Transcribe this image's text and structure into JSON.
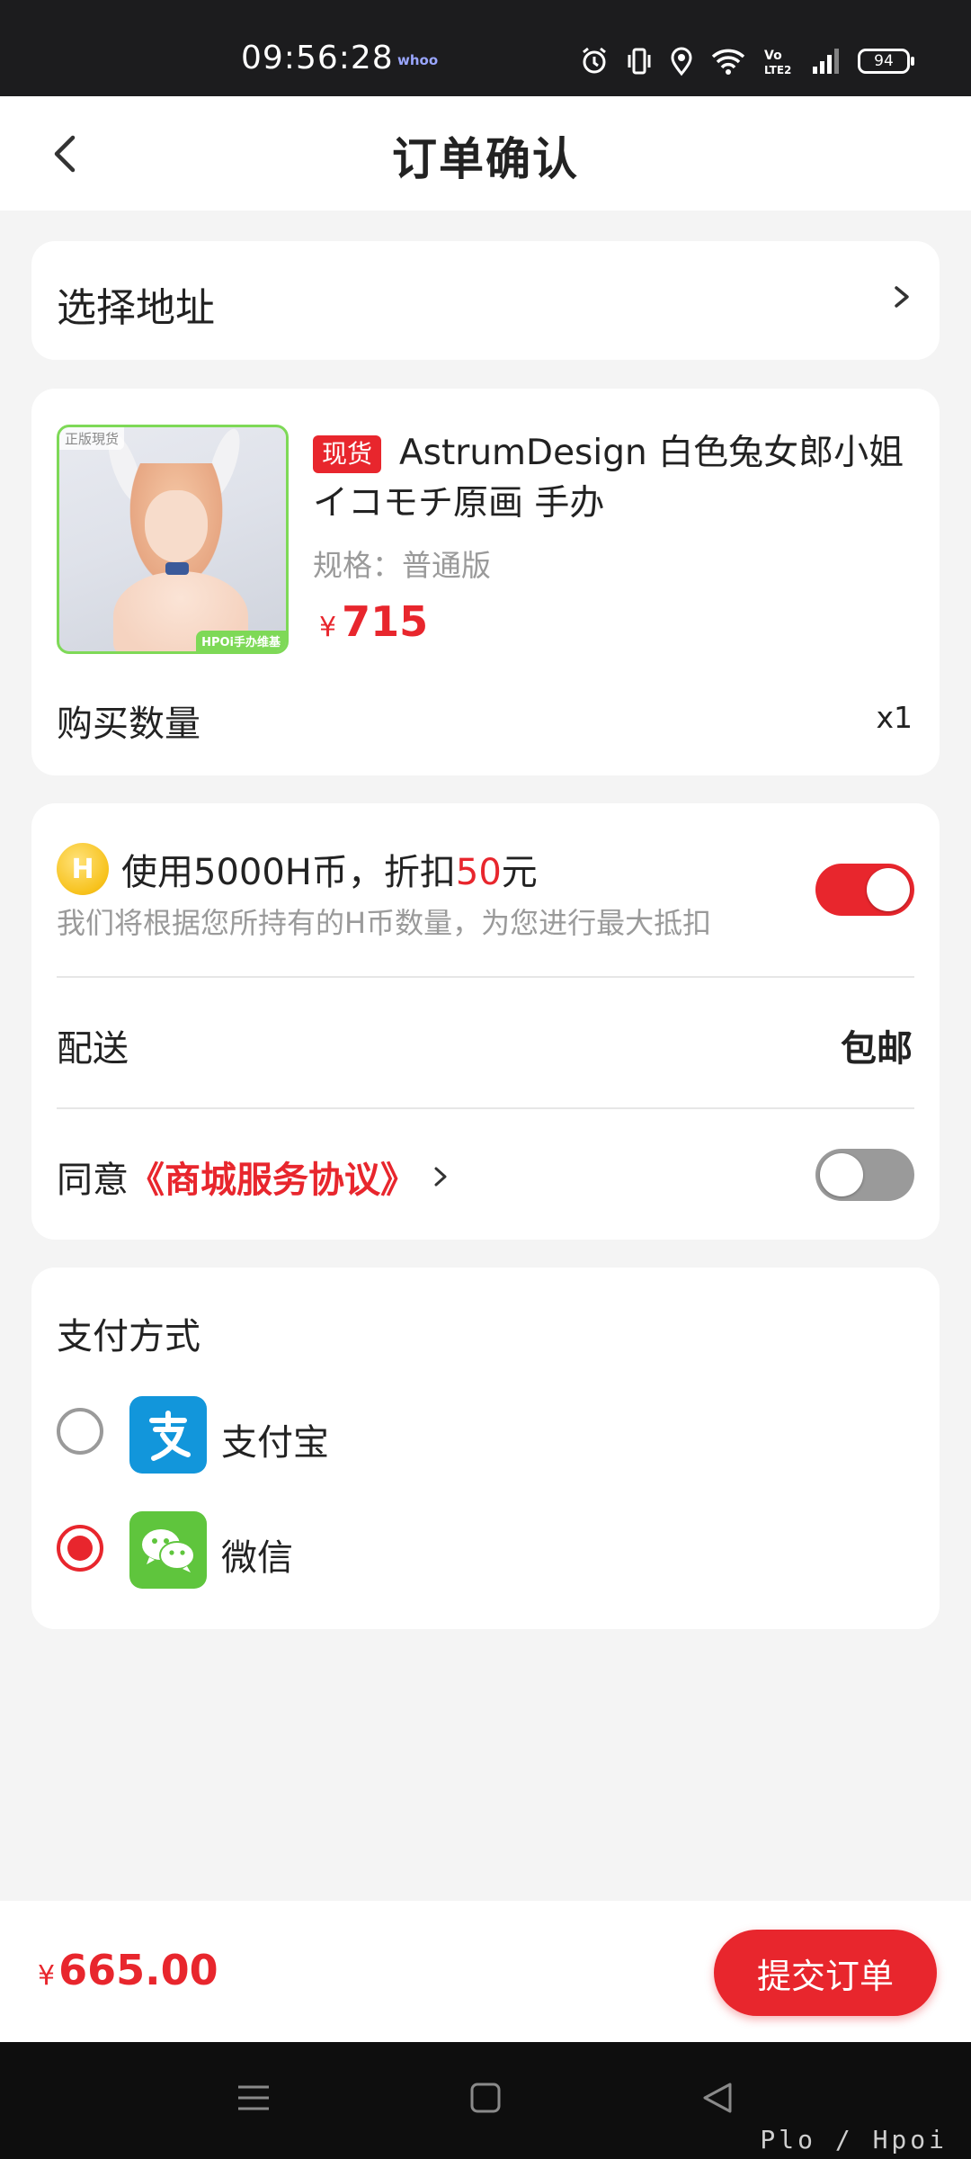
{
  "status_bar": {
    "time": "09:56:28",
    "carrier_mark": "whoo",
    "battery": "94",
    "icons": [
      "alarm-icon",
      "vibrate-icon",
      "location-icon",
      "wifi-icon",
      "volte-icon",
      "signal-icon",
      "battery-icon"
    ]
  },
  "header": {
    "title": "订单确认"
  },
  "address": {
    "label": "选择地址"
  },
  "product": {
    "stock_tag": "现货",
    "title": "AstrumDesign 白色兔女郎小姐 イコモチ原画 手办",
    "spec": "规格：普通版",
    "price_symbol": "¥",
    "price": "715",
    "image_tag": "正版現货",
    "image_brand": "HPOi手办维基",
    "qty_label": "购买数量",
    "qty_value": "x1"
  },
  "options": {
    "coin_badge": "H",
    "coin_prefix": "使用5000H币，折扣",
    "coin_amount": "50",
    "coin_suffix": "元",
    "coin_note": "我们将根据您所持有的H币数量，为您进行最大抵扣",
    "coin_enabled": true,
    "shipping_label": "配送",
    "shipping_value": "包邮",
    "agree_prefix": "同意",
    "agree_link": "《商城服务协议》",
    "agree_enabled": false
  },
  "payment": {
    "title": "支付方式",
    "methods": [
      {
        "label": "支付宝",
        "icon": "alipay-icon",
        "selected": false
      },
      {
        "label": "微信",
        "icon": "wechat-icon",
        "selected": true
      }
    ]
  },
  "footer": {
    "total_symbol": "¥",
    "total": "665.00",
    "submit_label": "提交订单"
  },
  "nav": {
    "icons": [
      "menu-icon",
      "home-icon",
      "back-icon"
    ],
    "watermark": "Plo / Hpoi"
  },
  "colors": {
    "accent": "#e8262d",
    "alipay": "#1296db",
    "wechat": "#5fc53d",
    "background": "#f4f4f4"
  }
}
